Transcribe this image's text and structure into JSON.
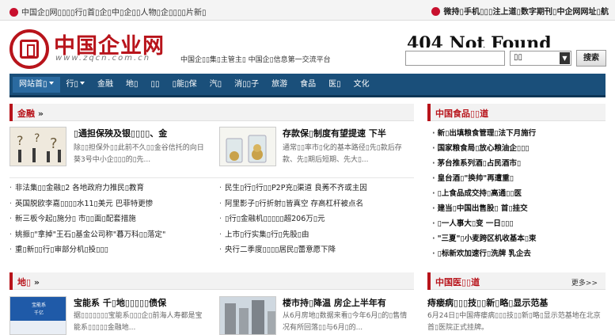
{
  "topbar": {
    "left_text": "中国企▯网▯▯▯▯行▯首▯企▯中▯企▯▯人物▯企▯▯▯▯片新▯",
    "right_text": "微持▯手机▯▯▯注上道▯数字期刊▯中企网网址▯航"
  },
  "header": {
    "logo_text": "中国企业网",
    "logo_url": "www.zqcn.com.cn",
    "info": "中国企▯▯集▯主管主▯ 中国企▯信息第一交流平台",
    "error_text": "404 Not Found"
  },
  "search": {
    "placeholder": "",
    "select_value": "▯▯",
    "button_label": "搜索"
  },
  "nav": {
    "items": [
      "网站首▯",
      "行▯",
      "金融",
      "地▯",
      "▯▯",
      "▯能▯保",
      "汽▯",
      "消▯▯子",
      "旅游",
      "食品",
      "医▯",
      "文化"
    ]
  },
  "finance": {
    "title": "金融",
    "feature1": {
      "title": "▯通担保殃及银▯▯▯▯、金",
      "desc": "除▯▯担保外▯▯此前不久▯▯金谷信托的向日葵3号中小企▯▯▯的▯先..."
    },
    "feature2": {
      "title": "存款保▯制度有望提速 下半",
      "desc": "通常▯▯率市▯化的基本路径▯先▯款后存款、先▯期后短期、先大▯..."
    },
    "left_list": [
      "非法集▯▯金融▯2 各地政府力推民▯教育",
      "英国脱欧李嘉▯▯▯▯水11▯美元 巴菲特更惨",
      "新三板今起▯施分▯ 市▯▯面▯配套措施",
      "姚振▯\"拿掉\"王石▯基金公司称\"暮万科▯▯落定\"",
      "重▯新▯▯行▯审部分机▯投▯▯▯"
    ],
    "mid_list": [
      "民生▯行▯行▯▯P2P充▯渠道 良莠不齐或主因",
      "阿里影子▯行折射▯皆真空 存高杠杆被点名",
      "▯行▯金融机▯▯▯▯▯超206万▯元",
      "上市▯行实集▯行▯先股▯由",
      "央行二季度▯▯▯▯居民▯蕾意愿下降"
    ]
  },
  "land": {
    "title": "地▯",
    "feature1": {
      "title": "宝能系 千▯地▯▯▯▯▯债保",
      "desc": "据▯▯▯▯▯▯▯宝能系▯▯▯企▯前海人寿都是宝能系▯▯▯▯▯金融地..."
    },
    "feature2": {
      "title": "楼市持▯降温 房企上半年有",
      "desc": "从6月房地▯数据来看▯今年6月▯的▯售情况有所回落▯▯与6月▯的..."
    }
  },
  "food": {
    "title": "中国食品▯▯道",
    "items": [
      "新▯出填粮食管理▯法下月施行",
      "国家粮食局▯放心粮油企▯▯▯",
      "茅台推系列酒▯占民酒市▯",
      "皇台酒▯\"换帅\"再遭重▯",
      "▯上食品成交持▯高通▯▯医",
      "建当▯中国出售股▯ 首▯挂交",
      "▯一人事大▯变 一日▯▯▯",
      "\"三夏\"▯小麦跨区机收基本▯束",
      "▯标新欢加速行▯洗牌 乳企去"
    ]
  },
  "medical": {
    "title": "中国医▯▯道",
    "more_label": "更多>>",
    "feature": {
      "title": "痔瘘病▯▯▯技▯▯新▯略▯显示范基",
      "desc": "6月24日▯中国痔瘘病▯▯▯技▯▯新▯略▯显示范基地在北京首▯医院正式挂牌。"
    }
  },
  "colors": {
    "brand_red": "#b8141b",
    "nav_blue": "#1a4f7a"
  }
}
